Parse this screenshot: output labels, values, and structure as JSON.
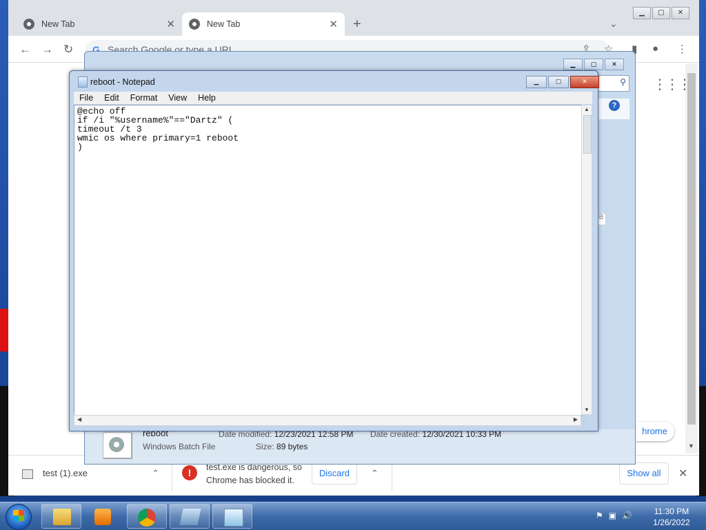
{
  "chrome": {
    "tabs": [
      {
        "label": "New Tab"
      },
      {
        "label": "New Tab"
      }
    ],
    "omnibox_placeholder": "Search Google or type a URL",
    "promo_pill": "hrome"
  },
  "download_bar": {
    "item_name": "test (1).exe",
    "warning_line1": "test.exe is dangerous, so",
    "warning_line2": "Chrome has blocked it.",
    "discard_label": "Discard",
    "show_all_label": "Show all"
  },
  "explorer": {
    "file_name": "reboot",
    "file_type": "Windows Batch File",
    "date_modified_label": "Date modified:",
    "date_modified_value": "12/23/2021 12:58 PM",
    "date_created_label": "Date created:",
    "date_created_value": "12/30/2021 10:33 PM",
    "size_label": "Size:",
    "size_value": "89 bytes",
    "side_letter": "B"
  },
  "notepad": {
    "title": "reboot - Notepad",
    "menu": [
      "File",
      "Edit",
      "Format",
      "View",
      "Help"
    ],
    "content": "@echo off\nif /i \"%username%\"==\"Dartz\" (\ntimeout /t 3\nwmic os where primary=1 reboot\n)"
  },
  "taskbar": {
    "time": "11:30 PM",
    "date": "1/26/2022"
  }
}
